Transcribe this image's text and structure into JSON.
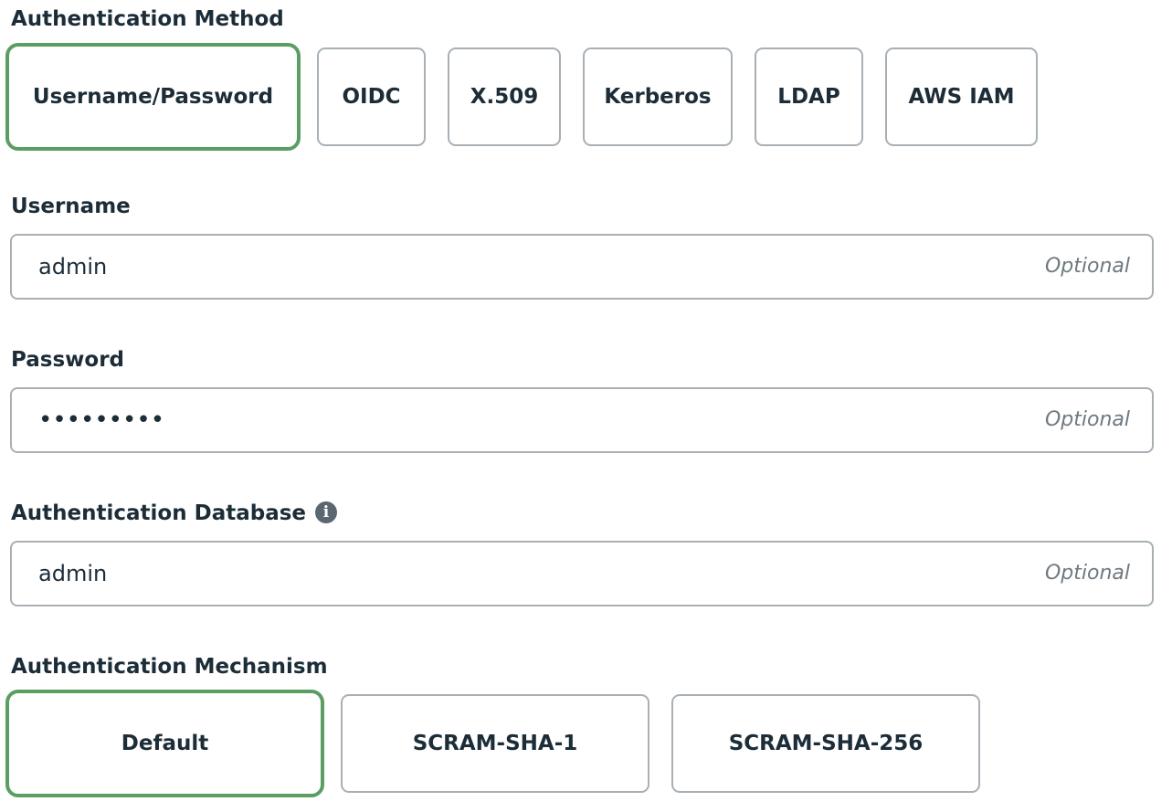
{
  "auth_method": {
    "label": "Authentication Method",
    "options": [
      {
        "label": "Username/Password",
        "selected": true
      },
      {
        "label": "OIDC",
        "selected": false
      },
      {
        "label": "X.509",
        "selected": false
      },
      {
        "label": "Kerberos",
        "selected": false
      },
      {
        "label": "LDAP",
        "selected": false
      },
      {
        "label": "AWS IAM",
        "selected": false
      }
    ]
  },
  "username": {
    "label": "Username",
    "value": "admin",
    "hint": "Optional"
  },
  "password": {
    "label": "Password",
    "value": "•••••••••",
    "hint": "Optional"
  },
  "auth_database": {
    "label": "Authentication Database",
    "info_icon": "info-circle-icon",
    "value": "admin",
    "hint": "Optional"
  },
  "auth_mechanism": {
    "label": "Authentication Mechanism",
    "options": [
      {
        "label": "Default",
        "selected": true
      },
      {
        "label": "SCRAM-SHA-1",
        "selected": false
      },
      {
        "label": "SCRAM-SHA-256",
        "selected": false
      }
    ]
  },
  "colors": {
    "selected_border": "#5a9e63",
    "border": "#a8b0b6",
    "text": "#1c2d38",
    "hint": "#6f7980"
  }
}
